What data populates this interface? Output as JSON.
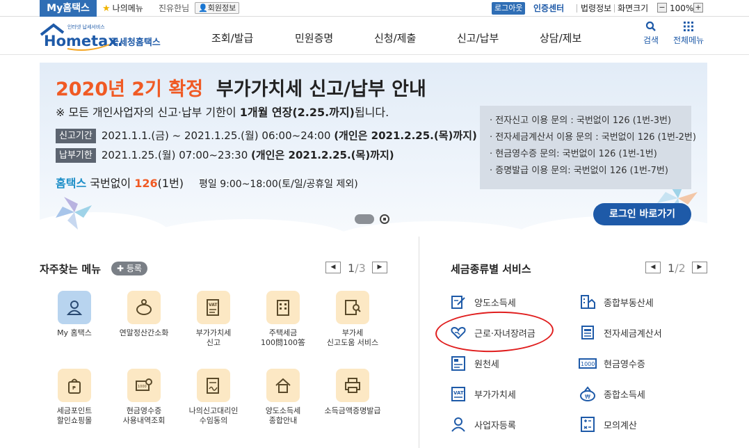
{
  "topbar": {
    "my_tab": "My홈택스",
    "my_menu": "나의메뉴",
    "user_name": "진유한님",
    "member_info": "회원정보",
    "logout": "로그아웃",
    "cert_center": "인증센터",
    "law_info": "법령정보",
    "screen_size": "화면크기",
    "zoom": "100%"
  },
  "header": {
    "logo_small": "인터넷 납세서비스",
    "logo_main": "Hometax.",
    "logo_sub": "국세청홈택스",
    "nav": [
      "조회/발급",
      "민원증명",
      "신청/제출",
      "신고/납부",
      "상담/제보"
    ],
    "search": "검색",
    "all_menu": "전체메뉴"
  },
  "banner": {
    "title_highlight": "2020년 2기 확정",
    "title_rest": "부가가치세 신고/납부 안내",
    "note_prefix": "※ 모든 개인사업자의 신고·납부 기한이 ",
    "note_bold": "1개월 연장(2.25.까지)",
    "note_suffix": "됩니다.",
    "report_tag": "신고기간",
    "report_text": "2021.1.1.(금) ~ 2021.1.25.(월) 06:00~24:00 ",
    "report_bold": "(개인은 2021.2.25.(목)까지)",
    "pay_tag": "납부기한",
    "pay_text": "2021.1.25.(월) 07:00~23:30 ",
    "pay_bold": "(개인은 2021.2.25.(목)까지)",
    "phone_brand": "홈택스",
    "phone_label": " 국번없이 ",
    "phone_num": "126",
    "phone_ext": "(1번)",
    "phone_hours": "평일 9:00~18:00(토/일/공휴일 제외)",
    "info": [
      "· 전자신고 이용 문의 : 국번없이 126 (1번-3번)",
      "· 전자세금계산서 이용 문의 : 국번없이 126 (1번-2번)",
      "· 현금영수증 문의: 국번없이 126 (1번-1번)",
      "· 증명발급 이용 문의: 국번없이 126 (1번-7번)"
    ],
    "login_button": "로그인 바로가기"
  },
  "favorites": {
    "title": "자주찾는 메뉴",
    "add": "등록",
    "page_current": "1",
    "page_sep": "/",
    "page_total": "3",
    "items": [
      {
        "label": "My 홈택스",
        "icon": "person-icon"
      },
      {
        "label": "연말정산간소화",
        "icon": "piggy-bank-icon"
      },
      {
        "label": "부가가치세\n신고",
        "icon": "vat-document-icon"
      },
      {
        "label": "주택세금\n100問100答",
        "icon": "building-icon"
      },
      {
        "label": "부가세\n신고도움 서비스",
        "icon": "search-document-icon"
      },
      {
        "label": "세금포인트\n할인쇼핑몰",
        "icon": "shopping-bag-icon"
      },
      {
        "label": "현금영수증\n사용내역조회",
        "icon": "receipt-search-icon"
      },
      {
        "label": "나의신고대리인\n수임동의",
        "icon": "signature-icon"
      },
      {
        "label": "양도소득세\n종합안내",
        "icon": "house-icon"
      },
      {
        "label": "소득금액증명발급",
        "icon": "printer-icon"
      }
    ]
  },
  "tax_service": {
    "title": "세금종류별 서비스",
    "page_current": "1",
    "page_sep": "/",
    "page_total": "2",
    "items": [
      {
        "label": "양도소득세",
        "icon": "transfer-document-icon"
      },
      {
        "label": "종합부동산세",
        "icon": "real-estate-icon"
      },
      {
        "label": "근로·자녀장려금",
        "icon": "heart-hands-icon"
      },
      {
        "label": "전자세금계산서",
        "icon": "invoice-icon"
      },
      {
        "label": "원천세",
        "icon": "withholding-document-icon"
      },
      {
        "label": "현금영수증",
        "icon": "cash-receipt-icon"
      },
      {
        "label": "부가가치세",
        "icon": "vat-icon"
      },
      {
        "label": "종합소득세",
        "icon": "money-bag-icon"
      },
      {
        "label": "사업자등록",
        "icon": "person-icon"
      },
      {
        "label": "모의계산",
        "icon": "calculator-icon"
      }
    ]
  },
  "colors": {
    "brand": "#1e5aa8",
    "accent": "#f05a24",
    "annotation": "#e01e1e"
  }
}
